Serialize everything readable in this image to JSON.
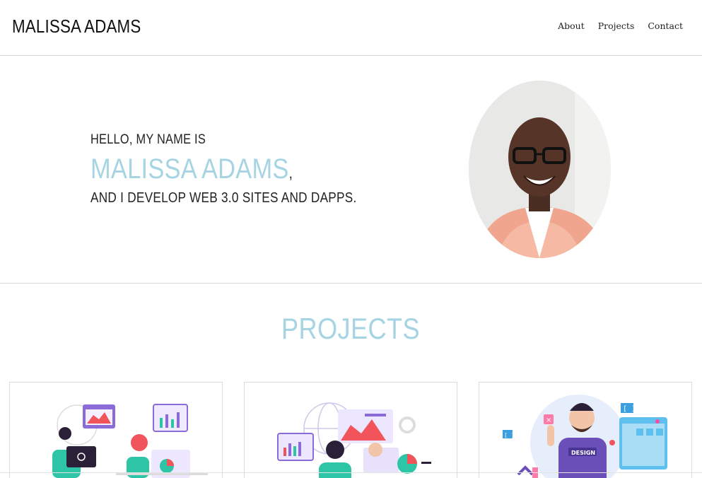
{
  "header": {
    "brand": "MALISSA ADAMS",
    "nav": [
      "About",
      "Projects",
      "Contact"
    ]
  },
  "hero": {
    "greeting": "HELLO, MY NAME IS",
    "name": "MALISSA ADAMS",
    "comma": ",",
    "tagline": "AND I DEVELOP WEB 3.0 SITES AND DAPPS."
  },
  "projects": {
    "title": "PROJECTS",
    "cards": [
      {
        "illustration": "analytics-team-illustration"
      },
      {
        "illustration": "data-dashboard-illustration"
      },
      {
        "illustration": "designer-illustration",
        "badge": "DESIGN"
      }
    ]
  },
  "colors": {
    "accent": "#a7d4e3",
    "text": "#111111",
    "divider": "#d6d6d6",
    "illustration_purple": "#8a6bd8",
    "illustration_teal": "#2ec4a6",
    "illustration_red": "#f2545b"
  }
}
